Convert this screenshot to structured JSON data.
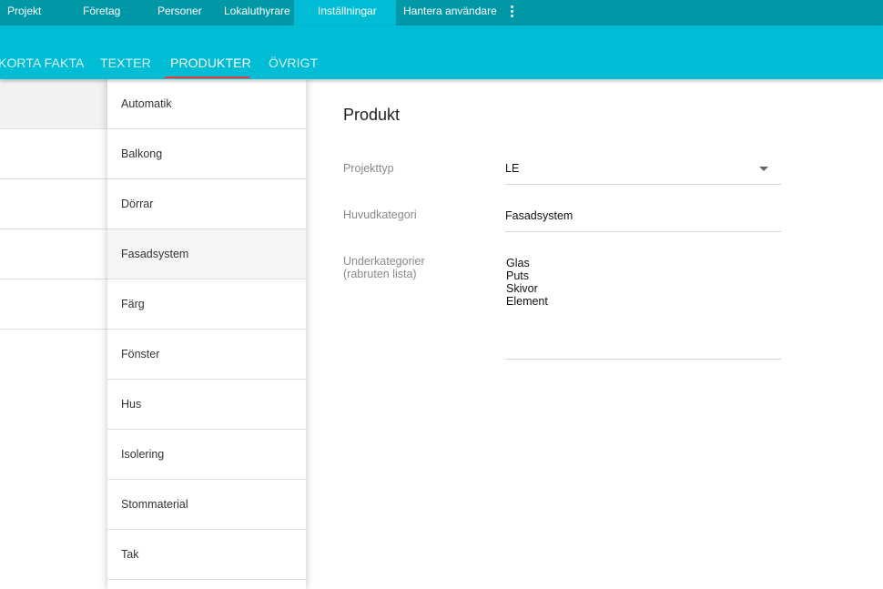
{
  "topnav": {
    "items": [
      {
        "label": "Projekt"
      },
      {
        "label": "Företag"
      },
      {
        "label": "Personer"
      },
      {
        "label": "Lokaluthyrare"
      },
      {
        "label": "Inställningar",
        "active": true
      },
      {
        "label": "Hantera användare"
      }
    ],
    "more_icon": "more-vertical-icon"
  },
  "tabs": [
    {
      "label": "KORTA FAKTA"
    },
    {
      "label": "TEXTER"
    },
    {
      "label": "PRODUKTER",
      "active": true
    },
    {
      "label": "ÖVRIGT"
    }
  ],
  "categories": [
    {
      "label": "Automatik"
    },
    {
      "label": "Balkong"
    },
    {
      "label": "Dörrar"
    },
    {
      "label": "Fasadsystem",
      "selected": true
    },
    {
      "label": "Färg"
    },
    {
      "label": "Fönster"
    },
    {
      "label": "Hus"
    },
    {
      "label": "Isolering"
    },
    {
      "label": "Stommaterial"
    },
    {
      "label": "Tak"
    }
  ],
  "form": {
    "title": "Produkt",
    "projekttyp": {
      "label": "Projekttyp",
      "value": "LE"
    },
    "huvudkategori": {
      "label": "Huvudkategori",
      "value": "Fasadsystem"
    },
    "underkategorier": {
      "label_line1": "Underkategorier",
      "label_line2": "(rabruten lista)",
      "values": [
        "Glas",
        "Puts",
        "Skivor",
        "Element"
      ]
    }
  },
  "colors": {
    "topnav_bg": "#0097a7",
    "tabbar_bg": "#00bcd4",
    "tab_indicator": "#e53935"
  }
}
